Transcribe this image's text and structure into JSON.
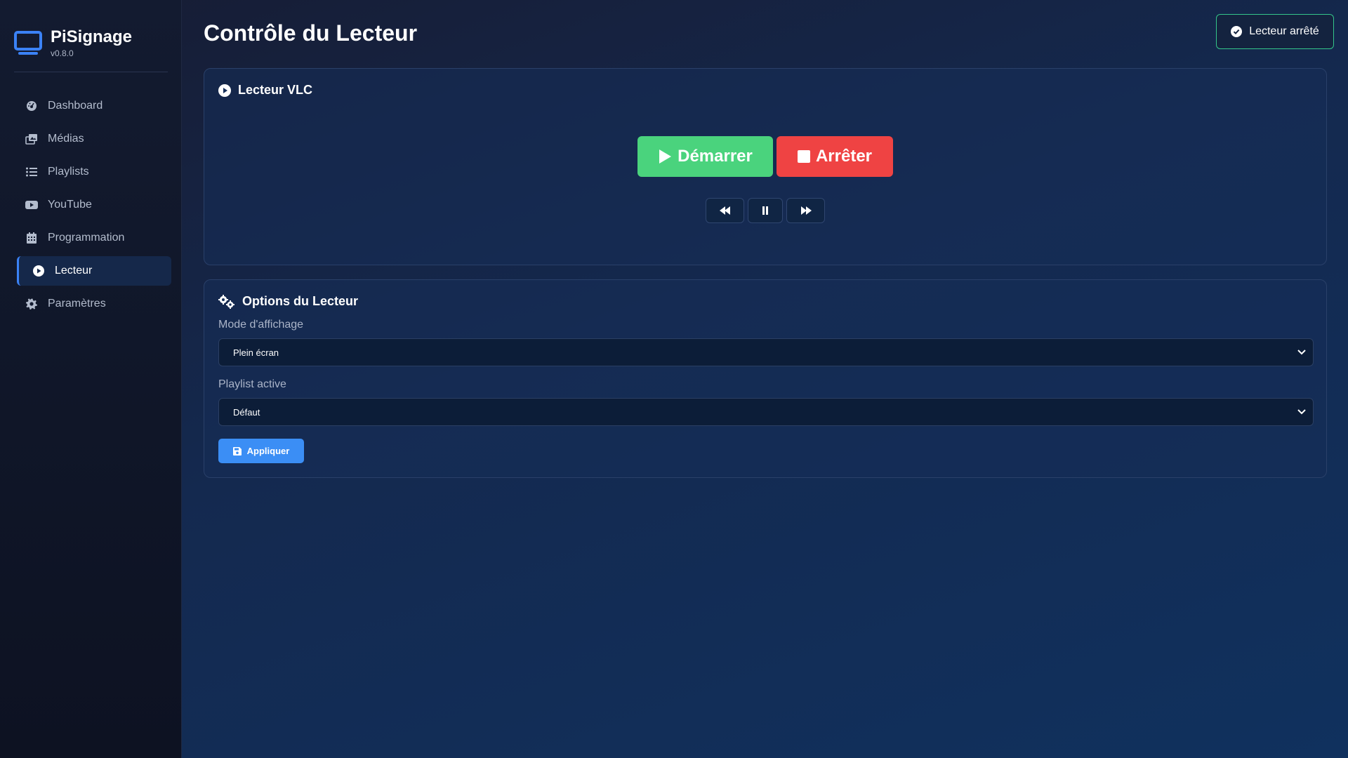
{
  "brand": {
    "name": "PiSignage",
    "version": "v0.8.0",
    "icon": "monitor-icon",
    "accent_color": "#3b82f6"
  },
  "sidebar": {
    "items": [
      {
        "label": "Dashboard",
        "icon": "gauge-icon",
        "active": false
      },
      {
        "label": "Médias",
        "icon": "images-icon",
        "active": false
      },
      {
        "label": "Playlists",
        "icon": "list-icon",
        "active": false
      },
      {
        "label": "YouTube",
        "icon": "youtube-icon",
        "active": false
      },
      {
        "label": "Programmation",
        "icon": "calendar-icon",
        "active": false
      },
      {
        "label": "Lecteur",
        "icon": "play-circle-icon",
        "active": true
      },
      {
        "label": "Paramètres",
        "icon": "gear-icon",
        "active": false
      }
    ]
  },
  "header": {
    "title": "Contrôle du Lecteur",
    "status": "Lecteur arrêté",
    "status_color": "#34c58a"
  },
  "vlc_card": {
    "title": "Lecteur VLC",
    "start_label": "Démarrer",
    "stop_label": "Arrêter",
    "start_color": "#4ad37d",
    "stop_color": "#ef4343"
  },
  "options_card": {
    "title": "Options du Lecteur",
    "display_mode_label": "Mode d'affichage",
    "display_mode_value": "Plein écran",
    "playlist_label": "Playlist active",
    "playlist_value": "Défaut",
    "apply_label": "Appliquer",
    "apply_color": "#3b8ef5"
  }
}
